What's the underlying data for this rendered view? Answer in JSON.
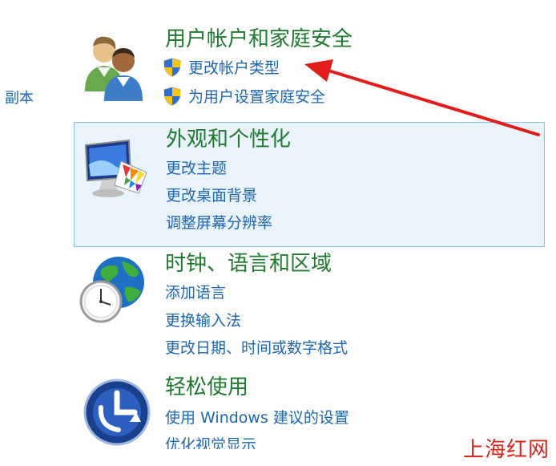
{
  "sidebar": {
    "copy_label": "副本"
  },
  "categories": [
    {
      "title": "用户帐户和家庭安全",
      "tasks": [
        "更改帐户类型",
        "为用户设置家庭安全"
      ]
    },
    {
      "title": "外观和个性化",
      "tasks": [
        "更改主题",
        "更改桌面背景",
        "调整屏幕分辨率"
      ]
    },
    {
      "title": "时钟、语言和区域",
      "tasks": [
        "添加语言",
        "更换输入法",
        "更改日期、时间或数字格式"
      ]
    },
    {
      "title": "轻松使用",
      "tasks": [
        "使用 Windows 建议的设置",
        "优化视觉显示"
      ]
    }
  ],
  "watermark": "上海红网",
  "colors": {
    "title_green": "#1e7a2f",
    "link_blue": "#1d66b0",
    "selection_bg": "#e8f3fb",
    "selection_border": "#86c1ec",
    "arrow_red": "#e21b1b"
  },
  "icons": {
    "cat0": "users-icon",
    "cat1": "monitor-palette-icon",
    "cat2": "globe-clock-icon",
    "cat3": "ease-of-access-icon",
    "task_shield": "uac-shield-icon"
  }
}
